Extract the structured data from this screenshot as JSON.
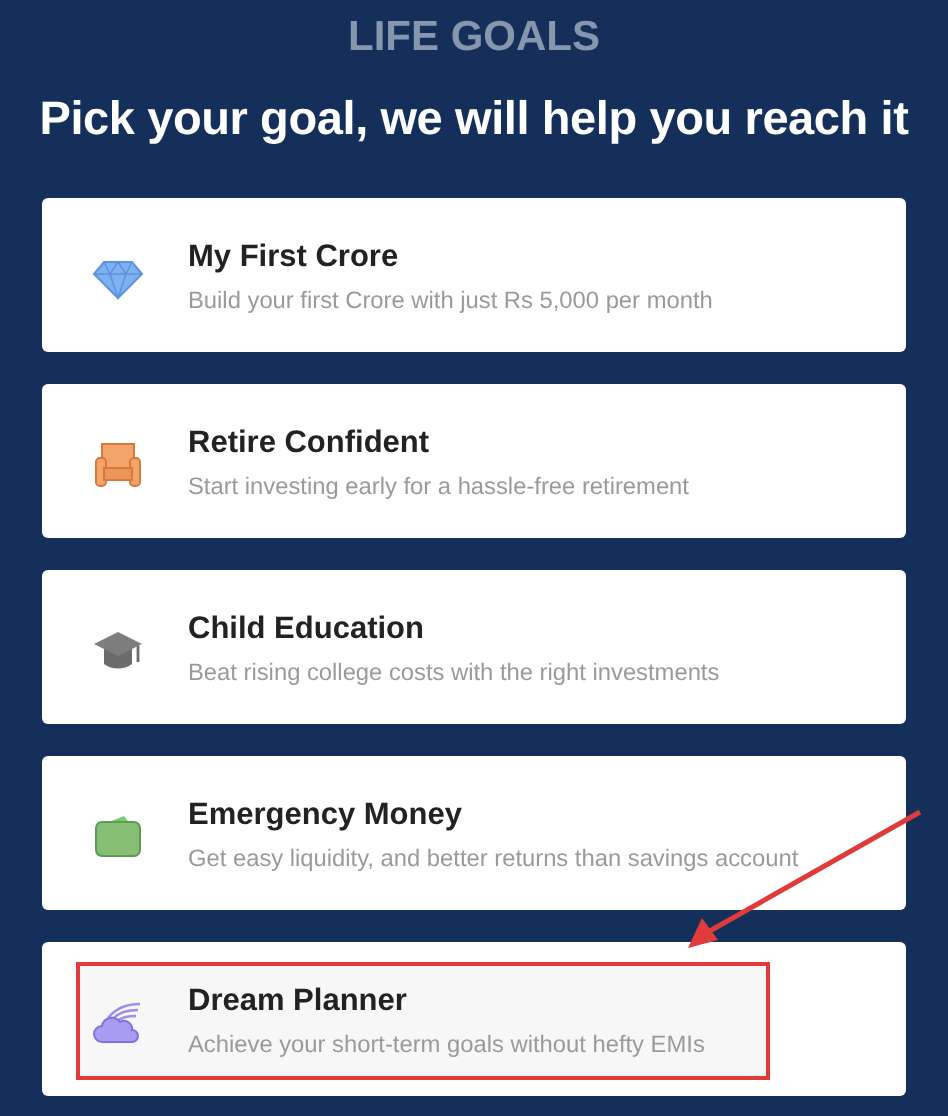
{
  "header": {
    "eyebrow": "LIFE GOALS",
    "title": "Pick your goal, we will help you reach it"
  },
  "goals": [
    {
      "kind": "diamond",
      "title": "My First Crore",
      "subtitle": "Build your first Crore with just Rs 5,000 per month",
      "highlighted": false
    },
    {
      "kind": "armchair",
      "title": "Retire Confident",
      "subtitle": "Start investing early for a hassle-free retirement",
      "highlighted": false
    },
    {
      "kind": "cap",
      "title": "Child Education",
      "subtitle": "Beat rising college costs with the right investments",
      "highlighted": false
    },
    {
      "kind": "wallet",
      "title": "Emergency Money",
      "subtitle": "Get easy liquidity, and better returns than savings account",
      "highlighted": false
    },
    {
      "kind": "cloud",
      "title": "Dream Planner",
      "subtitle": "Achieve your short-term goals without hefty EMIs",
      "highlighted": true
    }
  ]
}
